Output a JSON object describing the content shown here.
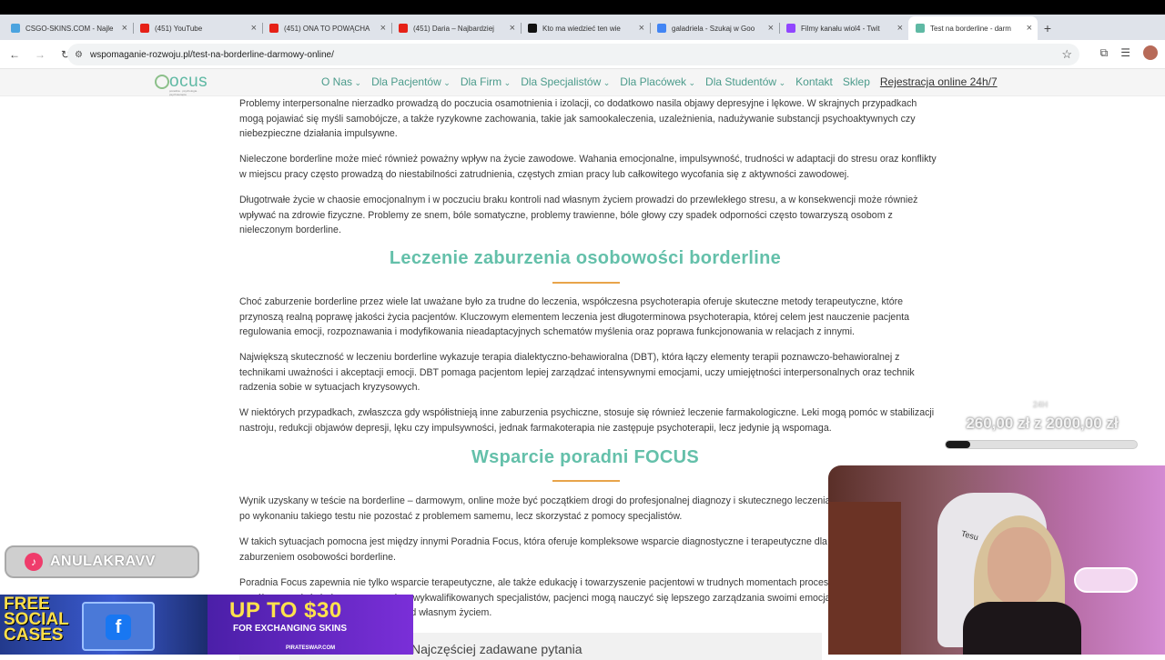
{
  "browser": {
    "tabs": [
      {
        "title": "CSGO-SKINS.COM - Najle",
        "icon_color": "#4aa3df",
        "active": false
      },
      {
        "title": "(451) YouTube",
        "icon_color": "#e62117",
        "active": false
      },
      {
        "title": "(451) ONA TO POWĄCHA",
        "icon_color": "#e62117",
        "active": false
      },
      {
        "title": "(451) Daria – Najbardziej",
        "icon_color": "#e62117",
        "active": false
      },
      {
        "title": "Kto ma wiedzieć ten wie",
        "icon_color": "#111111",
        "active": false
      },
      {
        "title": "galadriela - Szukaj w Goo",
        "icon_color": "#4285f4",
        "active": false
      },
      {
        "title": "Filmy kanału wiol4 - Twit",
        "icon_color": "#9146ff",
        "active": false
      },
      {
        "title": "Test na borderline - darm",
        "icon_color": "#5fb9a4",
        "active": true
      }
    ],
    "new_tab_symbol": "+",
    "close_symbol": "×",
    "url": "wspomaganie-rozwoju.pl/test-na-borderline-darmowy-online/"
  },
  "site": {
    "logo_text": "ocus",
    "logo_tagline": "poradnia · psychologia · psychoterapia",
    "menu": [
      "O Nas",
      "Dla Pacjentów",
      "Dla Firm",
      "Dla Specjalistów",
      "Dla Placówek",
      "Dla Studentów",
      "Kontakt",
      "Sklep"
    ],
    "menu_has_dropdown": [
      true,
      true,
      true,
      true,
      true,
      true,
      false,
      false
    ],
    "registration": "Rejestracja online 24h/7"
  },
  "article": {
    "p1": "Problemy interpersonalne nierzadko prowadzą do poczucia osamotnienia i izolacji, co dodatkowo nasila objawy depresyjne i lękowe. W skrajnych przypadkach mogą pojawiać się myśli samobójcze, a także ryzykowne zachowania, takie jak samookaleczenia, uzależnienia, nadużywanie substancji psychoaktywnych czy niebezpieczne działania impulsywne.",
    "p2": "Nieleczone borderline może mieć również poważny wpływ na życie zawodowe. Wahania emocjonalne, impulsywność, trudności w adaptacji do stresu oraz konflikty w miejscu pracy często prowadzą do niestabilności zatrudnienia, częstych zmian pracy lub całkowitego wycofania się z aktywności zawodowej.",
    "p3": "Długotrwałe życie w chaosie emocjonalnym i w poczuciu braku kontroli nad własnym życiem prowadzi do przewlekłego stresu, a w konsekwencji może również wpływać na zdrowie fizyczne. Problemy ze snem, bóle somatyczne, problemy trawienne, bóle głowy czy spadek odporności często towarzyszą osobom z nieleczonym borderline.",
    "h1": "Leczenie zaburzenia osobowości borderline",
    "p4": "Choć zaburzenie borderline przez wiele lat uważane było za trudne do leczenia, współczesna psychoterapia oferuje skuteczne metody terapeutyczne, które przynoszą realną poprawę jakości życia pacjentów. Kluczowym elementem leczenia jest długoterminowa psychoterapia, której celem jest nauczenie pacjenta regulowania emocji, rozpoznawania i modyfikowania nieadaptacyjnych schematów myślenia oraz poprawa funkcjonowania w relacjach z innymi.",
    "p5": "Największą skuteczność w leczeniu borderline wykazuje terapia dialektyczno-behawioralna (DBT), która łączy elementy terapii poznawczo-behawioralnej z technikami uważności i akceptacji emocji. DBT pomaga pacjentom lepiej zarządzać intensywnymi emocjami, uczy umiejętności interpersonalnych oraz technik radzenia sobie w sytuacjach kryzysowych.",
    "p6": "W niektórych przypadkach, zwłaszcza gdy współistnieją inne zaburzenia psychiczne, stosuje się również leczenie farmakologiczne. Leki mogą pomóc w stabilizacji nastroju, redukcji objawów depresji, lęku czy impulsywności, jednak farmakoterapia nie zastępuje psychoterapii, lecz jedynie ją wspomaga.",
    "h2": "Wsparcie poradni FOCUS",
    "p7": "Wynik uzyskany w teście na borderline – darmowym, online może być początkiem drogi do profesjonalnej diagnozy i skutecznego leczenia. Ważne jest jednak, by po wykonaniu takiego testu nie pozostać z problemem samemu, lecz skorzystać z pomocy specjalistów.",
    "p8": "W takich sytuacjach pomocna jest między innymi Poradnia Focus, która oferuje kompleksowe wsparcie diagnostyczne i terapeutyczne dla osób zmagających się z zaburzeniem osobowości borderline.",
    "p9": "Poradnia Focus zapewnia nie tylko wsparcie terapeutyczne, ale także edukację i towarzyszenie pacjentowi w trudnych momentach procesu leczenia. Dzięki współpracy z doświadczonym zespołem wykwalifikowanych specjalistów, pacjenci mogą nauczyć się lepszego zarządzania swoimi emocjami, budowania zdrowszych relacji i przejęcia kontroli nad własnym życiem.",
    "faq_title": "Najczęściej zadawane pytania"
  },
  "overlay": {
    "goal_label": "24H",
    "goal_amount": "260,00 zł z 2000,00 zł",
    "goal_progress": 0.13,
    "tiktok_handle": "ANULAKRAVV",
    "ad1_text": "FREE SOCIAL CASES",
    "ad2_big": "UP TO $30",
    "ad2_sub": "FOR EXCHANGING SKINS",
    "ad2_domain": "PIRATESWAP.COM",
    "chair_brand": "Tesu"
  }
}
